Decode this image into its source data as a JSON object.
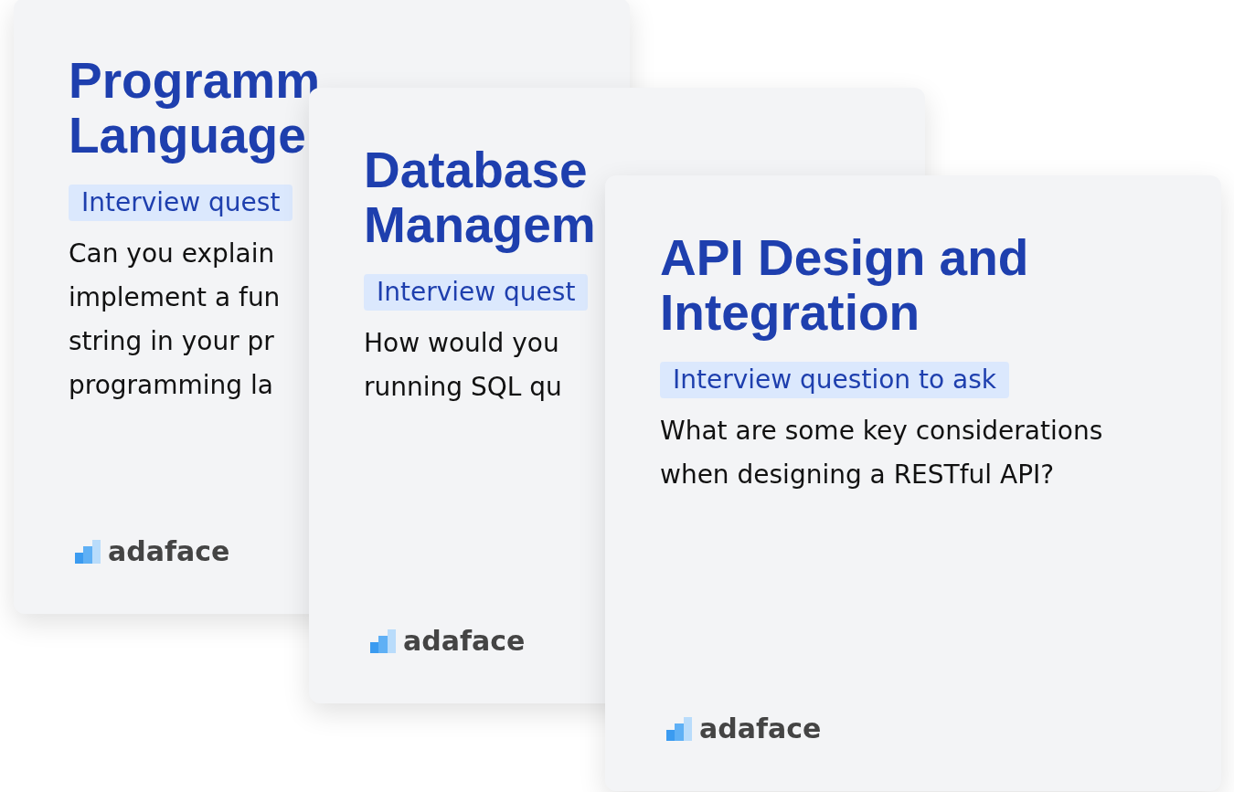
{
  "cards": [
    {
      "title_lines": [
        "Programm",
        "Language"
      ],
      "tag": "Interview quest",
      "question_lines": [
        "Can you explain",
        "implement a fun",
        "string in your pr",
        "programming la"
      ],
      "logo": "adaface"
    },
    {
      "title_lines": [
        "Database",
        "Managem"
      ],
      "tag": "Interview quest",
      "question_lines": [
        "How would you",
        "running SQL qu"
      ],
      "logo": "adaface"
    },
    {
      "title_lines": [
        "API Design and",
        "Integration"
      ],
      "tag": "Interview question to ask",
      "question_lines": [
        "What are some key considerations",
        "when designing a RESTful API?"
      ],
      "logo": "adaface"
    }
  ]
}
